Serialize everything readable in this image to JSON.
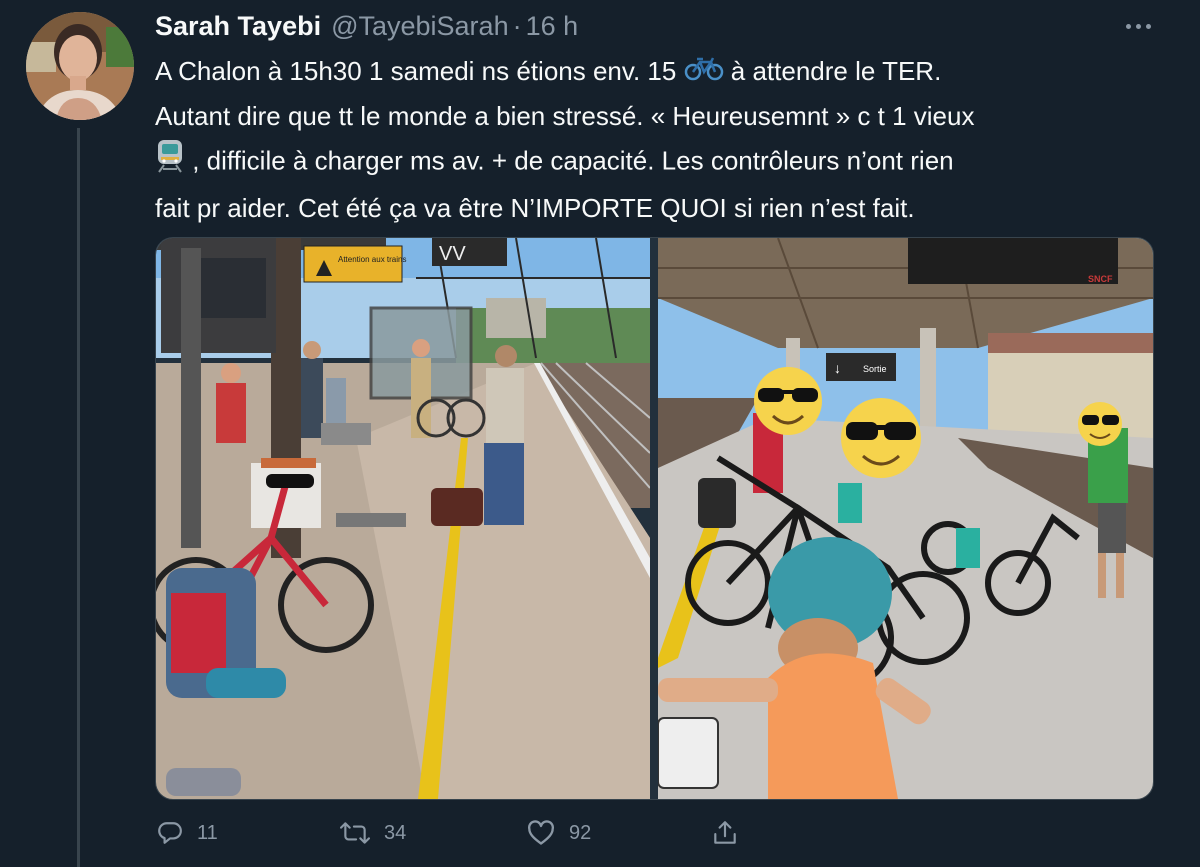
{
  "tweet": {
    "display_name": "Sarah Tayebi",
    "handle": "@TayebiSarah",
    "separator": "·",
    "time": "16 h",
    "text_lines": [
      {
        "before": "A Chalon à 15h30 1 samedi ns étions env. 15 ",
        "emoji": "bicycle-emoji",
        "after": " à attendre le TER."
      },
      {
        "before": "Autant dire que tt le monde a bien stressé. « Heureusemnt » c t 1 vieux",
        "emoji": "",
        "after": ""
      },
      {
        "before": "",
        "emoji": "train-emoji",
        "after": " , difficile à charger ms av. + de capacité. Les contrôleurs n’ont rien"
      },
      {
        "before": "fait pr aider. Cet été ça va être N’IMPORTE QUOI si rien n’est fait.",
        "emoji": "",
        "after": ""
      }
    ],
    "photo_signs": {
      "warning_sign": "Attention aux trains",
      "platform_sign": "VV",
      "exit_sign": "Sortie",
      "exit_arrow": "↓",
      "brand": "SNCF"
    },
    "actions": {
      "replies": "11",
      "retweets": "34",
      "likes": "92"
    },
    "icons": {
      "reply": "reply-icon",
      "retweet": "retweet-icon",
      "like": "heart-icon",
      "share": "share-icon",
      "more": "more-icon"
    }
  },
  "colors": {
    "background": "#15202b",
    "text_primary": "#f7f9f9",
    "text_secondary": "#8b98a5",
    "border": "#38444d"
  }
}
